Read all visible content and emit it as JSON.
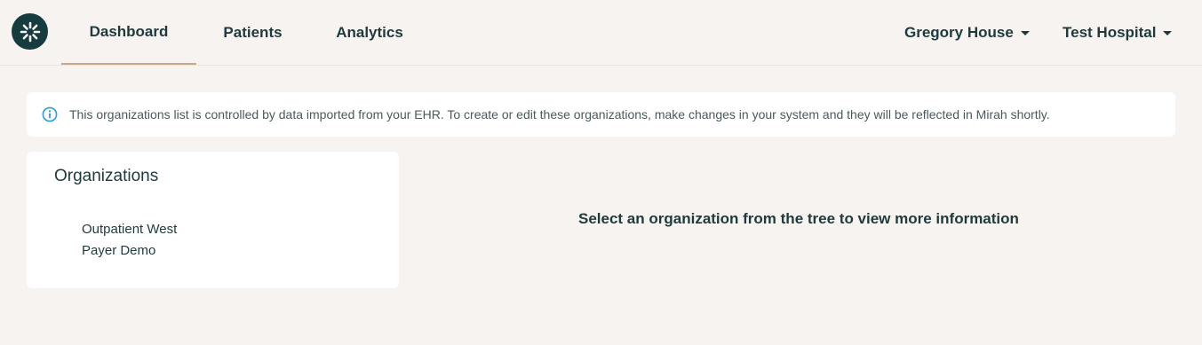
{
  "nav": {
    "logo_icon": "mirah-star-logo-icon",
    "tabs": [
      {
        "label": "Dashboard",
        "active": true
      },
      {
        "label": "Patients",
        "active": false
      },
      {
        "label": "Analytics",
        "active": false
      }
    ],
    "user_menu": "Gregory House",
    "org_menu": "Test Hospital"
  },
  "banner": {
    "icon": "info-icon",
    "text": "This organizations list is controlled by data imported from your EHR. To create or edit these organizations, make changes in your system and they will be reflected in Mirah shortly."
  },
  "organizations": {
    "title": "Organizations",
    "items": [
      "Outpatient West",
      "Payer Demo"
    ]
  },
  "detail": {
    "empty_message": "Select an organization from the tree to view more information"
  },
  "colors": {
    "background": "#f6f3f0",
    "brand_dark": "#163c40",
    "active_underline": "#c8a98a",
    "info_blue": "#2c9ed8"
  }
}
